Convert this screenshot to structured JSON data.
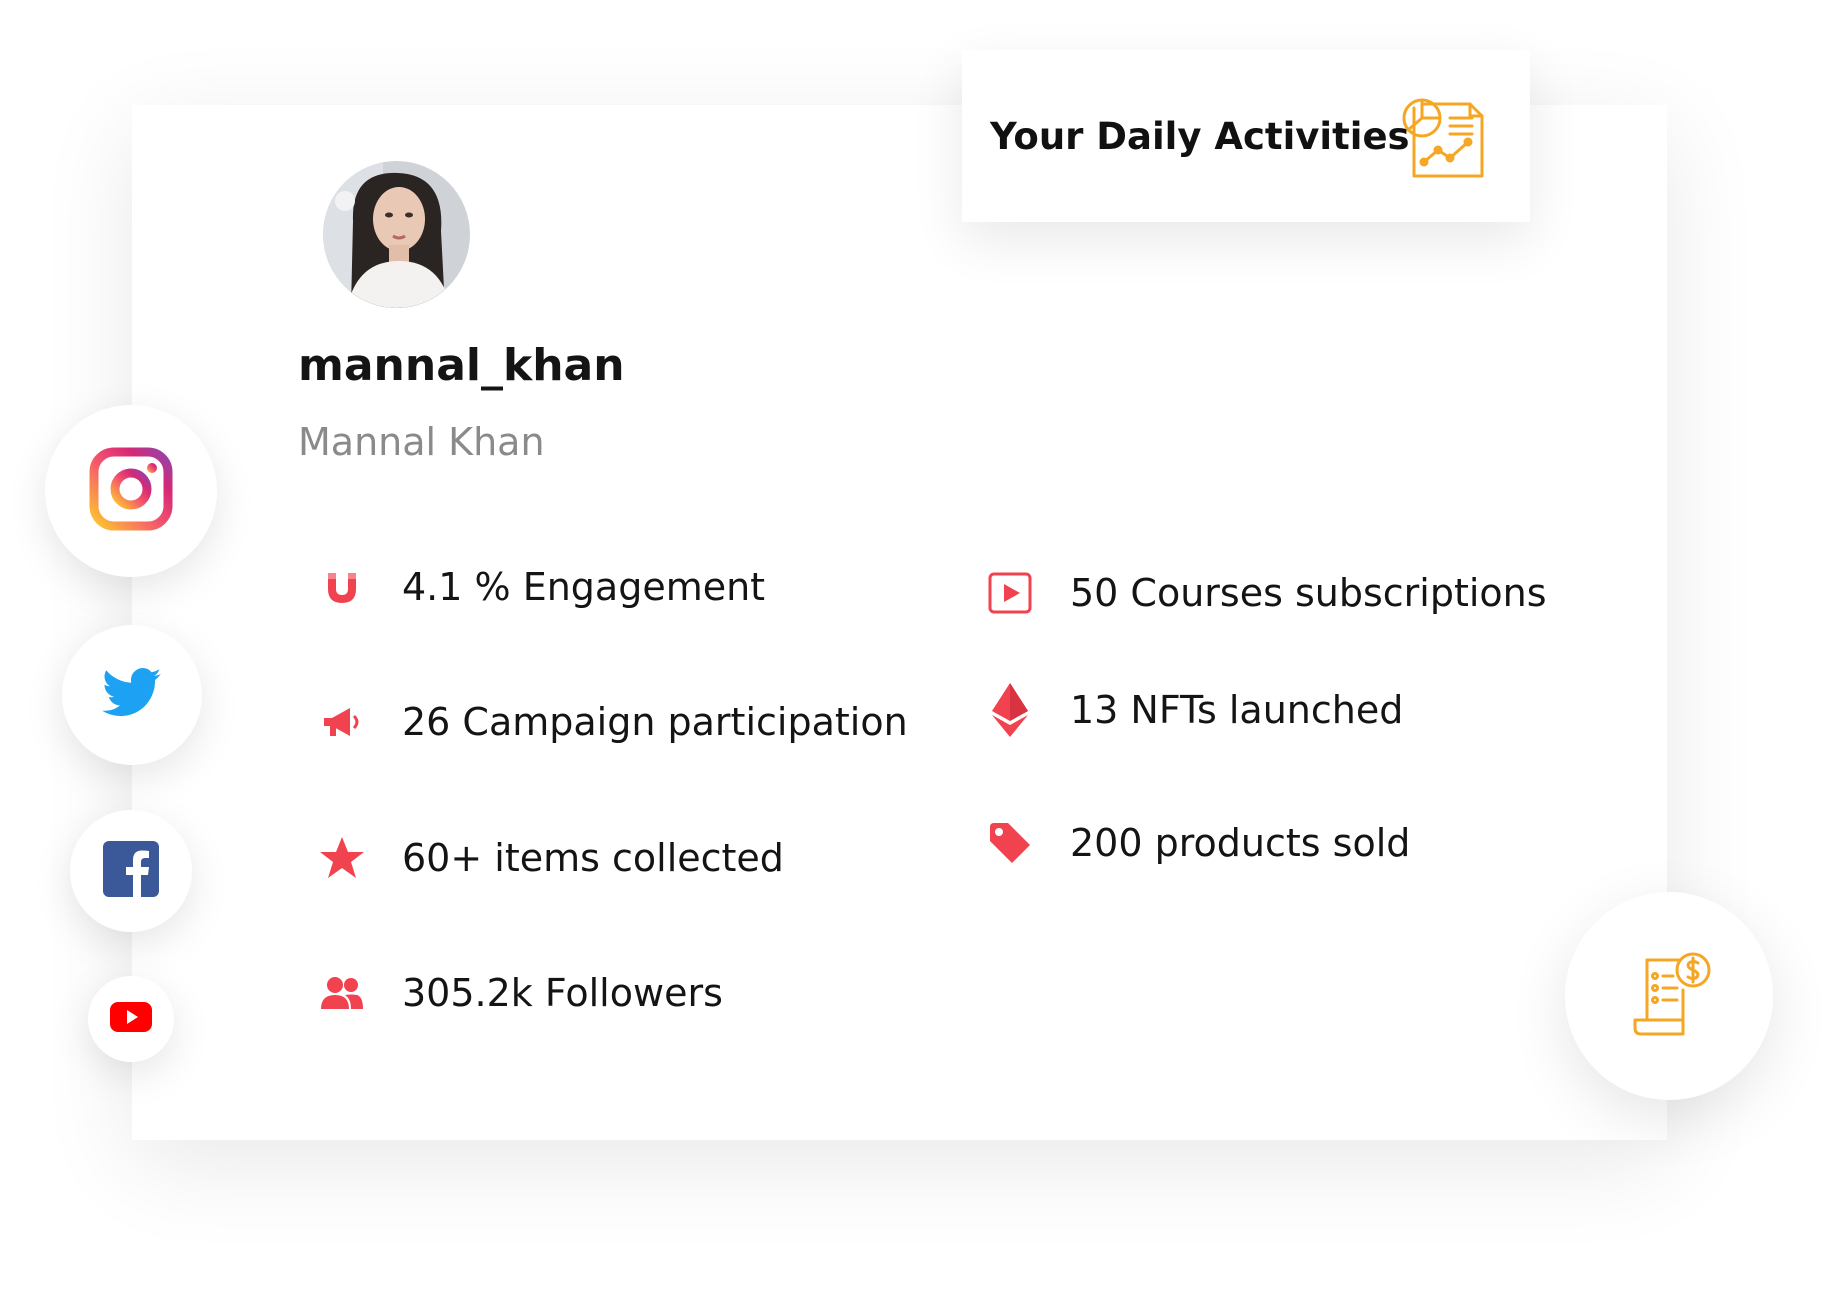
{
  "activity": {
    "title": "Your Daily Activities",
    "icon": "report-chart-icon"
  },
  "profile": {
    "username": "mannal_khan",
    "full_name": "Mannal Khan",
    "avatar": "avatar"
  },
  "stats_left": [
    {
      "icon": "magnet-icon",
      "label": "4.1 % Engagement"
    },
    {
      "icon": "megaphone-icon",
      "label": "26 Campaign participation"
    },
    {
      "icon": "star-icon",
      "label": "60+ items collected"
    },
    {
      "icon": "users-icon",
      "label": "305.2k Followers"
    }
  ],
  "stats_right": [
    {
      "icon": "play-icon",
      "label": "50 Courses subscriptions"
    },
    {
      "icon": "ethereum-icon",
      "label": "13 NFTs launched"
    },
    {
      "icon": "tag-icon",
      "label": "200 products sold"
    }
  ],
  "social": [
    {
      "name": "instagram-icon"
    },
    {
      "name": "twitter-icon"
    },
    {
      "name": "facebook-icon"
    },
    {
      "name": "youtube-icon"
    }
  ],
  "colors": {
    "accent_red": "#f0434f",
    "accent_orange": "#f5a623",
    "twitter_blue": "#1da1f2",
    "facebook_blue": "#3b5998",
    "youtube_red": "#ff0000"
  }
}
